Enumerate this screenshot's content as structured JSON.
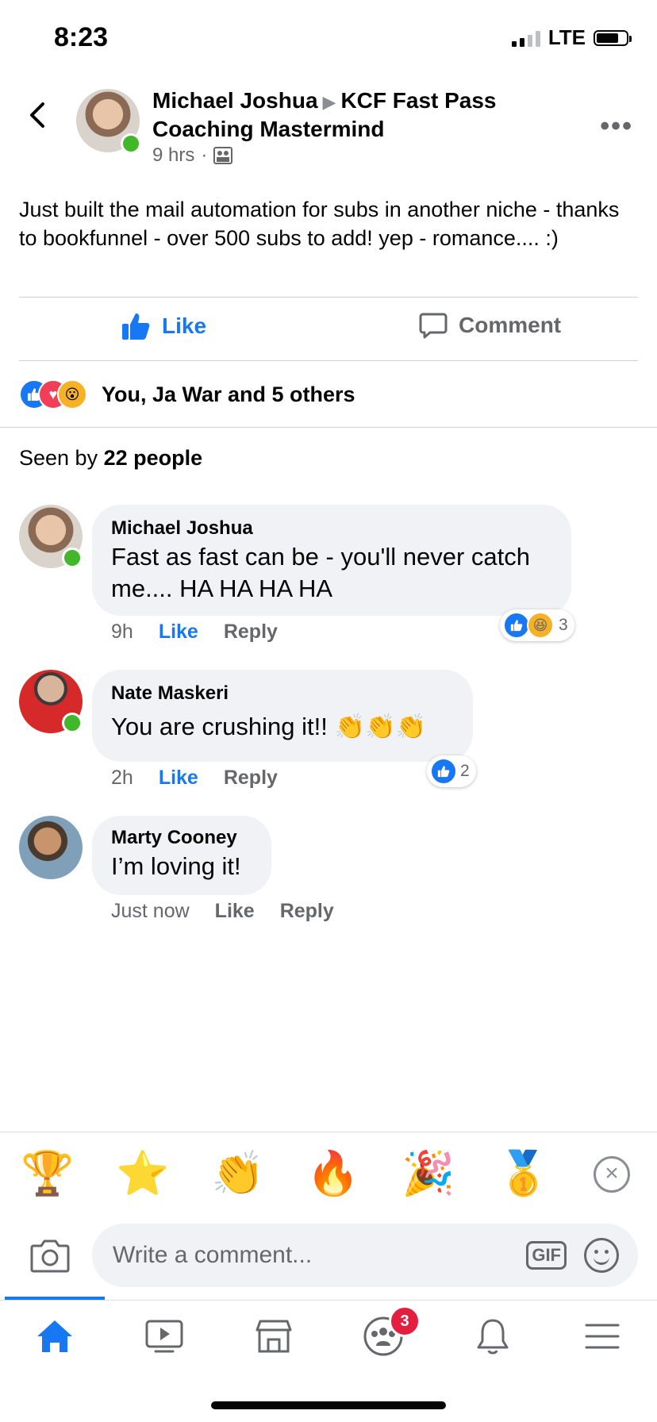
{
  "status": {
    "time": "8:23",
    "network": "LTE"
  },
  "post": {
    "author": "Michael Joshua",
    "group": "KCF Fast Pass Coaching Mastermind",
    "time": "9 hrs",
    "text": "Just built the mail automation for subs in another niche - thanks to bookfunnel - over 500 subs to add!  yep - romance.... :)",
    "like_label": "Like",
    "comment_label": "Comment",
    "reactions_summary": "You, Ja War and 5 others",
    "seen_prefix": "Seen by",
    "seen_count": "22 people"
  },
  "comments": [
    {
      "name": "Michael Joshua",
      "text": "Fast as fast can be - you'll never catch me....  HA HA HA HA",
      "time": "9h",
      "like": "Like",
      "reply": "Reply",
      "reaction_count": "3"
    },
    {
      "name": "Nate Maskeri",
      "text": "You are crushing it!!  👏👏👏",
      "time": "2h",
      "like": "Like",
      "reply": "Reply",
      "reaction_count": "2"
    },
    {
      "name": "Marty Cooney",
      "text": "I’m loving it!",
      "time": "Just now",
      "like": "Like",
      "reply": "Reply"
    }
  ],
  "emoji_bar": [
    "🏆",
    "⭐",
    "👏",
    "🔥",
    "🎉",
    "🥇"
  ],
  "compose": {
    "placeholder": "Write a comment...",
    "gif_label": "GIF"
  },
  "tabs": {
    "groups_badge": "3"
  },
  "colors": {
    "accent": "#1877f2",
    "online": "#42b72a",
    "bubble": "#f0f2f5",
    "badge": "#e41e3f"
  }
}
